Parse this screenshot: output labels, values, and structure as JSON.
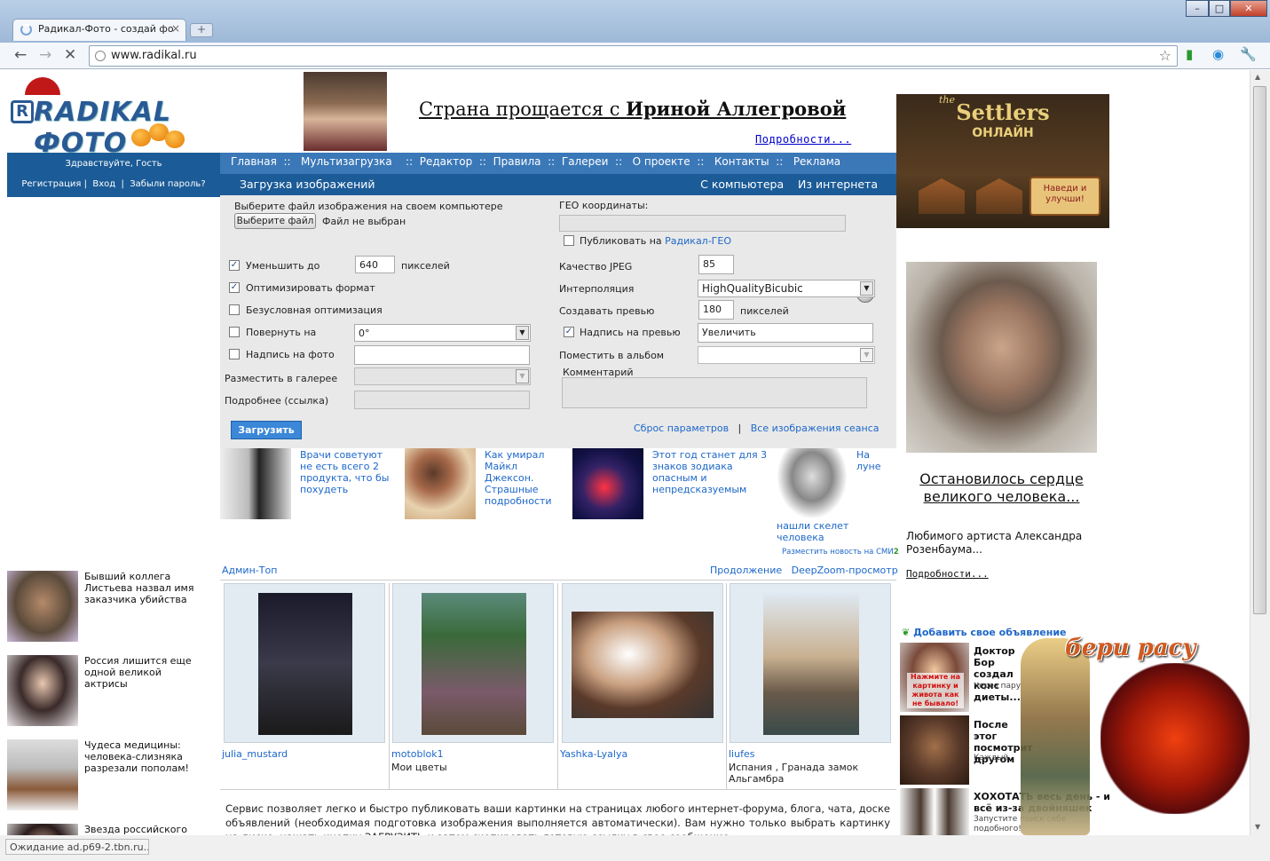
{
  "browser": {
    "tab_title": "Радикал-Фото - создай фо",
    "tab_close": "×",
    "new_tab": "+",
    "url": "www.radikal.ru",
    "status": "Ожидание ad.p69-2.tbn.ru...",
    "win_min": "–",
    "win_max": "□",
    "win_close": "✕"
  },
  "logo": {
    "letter": "R",
    "text": "RADIKAL ФОТО"
  },
  "banner": {
    "title_prefix": "Страна прощается с ",
    "title_bold": "Ириной Аллегровой",
    "more": "Подробности..."
  },
  "user_box": {
    "greeting": "Здравствуйте, Гость",
    "register": "Регистрация",
    "login": "Вход",
    "forgot": "Забыли пароль?",
    "sep": "|"
  },
  "nav": {
    "items": [
      "Главная",
      "Мультизагрузка",
      "Редактор",
      "Правила",
      "Галереи",
      "О проекте",
      "Контакты",
      "Реклама"
    ],
    "sep": "::"
  },
  "upload": {
    "title": "Загрузка изображений",
    "from_computer": "С компьютера",
    "from_internet": "Из интернета",
    "choose_label": "Выберите файл изображения на своем компьютере",
    "choose_button": "Выберите файл",
    "no_file": "Файл не выбран",
    "reduce_label": "Уменьшить до",
    "reduce_value": "640",
    "pixels": "пикселей",
    "optimize_label": "Оптимизировать формат",
    "force_opt_label": "Безусловная оптимизация",
    "rotate_label": "Повернуть на",
    "rotate_value": "0°",
    "caption_label": "Надпись на фото",
    "gallery_label": "Разместить в галерее",
    "more_link_label": "Подробнее (ссылка)",
    "geo_label": "ГЕО координаты:",
    "geo_publish": "Публиковать на",
    "geo_link": "Радикал-ГЕО",
    "jpeg_label": "Качество JPEG",
    "jpeg_value": "85",
    "interp_label": "Интерполяция",
    "interp_value": "HighQualityBicubic",
    "preview_label": "Создавать превью",
    "preview_value": "180",
    "preview_caption_label": "Надпись на превью",
    "preview_caption_value": "Увеличить",
    "album_label": "Поместить в альбом",
    "comment_label": "Комментарий",
    "submit": "Загрузить",
    "reset": "Сброс параметров",
    "all_images": "Все изображения сеанса",
    "sep": "|"
  },
  "news": [
    {
      "text": "Врачи советуют не есть всего 2 продукта, что бы похудеть"
    },
    {
      "text": "Как умирал Майкл Джексон. Страшные подробности"
    },
    {
      "text": "Этот год станет для 3 знаков зодиака опасным и непредсказуемым"
    },
    {
      "text_a": "На луне",
      "text_b": "нашли скелет человека"
    }
  ],
  "news_place": {
    "text": "Разместить новость на СМИ",
    "suffix": "2"
  },
  "gallery": {
    "admin_top": "Админ-Топ",
    "continue": "Продолжение",
    "deepzoom": "DeepZoom-просмотр",
    "items": [
      {
        "user": "julia_mustard",
        "desc": ""
      },
      {
        "user": "motoblok1",
        "desc": "Мои цветы"
      },
      {
        "user": "Yashka-Lyalya",
        "desc": ""
      },
      {
        "user": "liufes",
        "desc": "Испания , Гранада замок Альгамбра"
      }
    ]
  },
  "left_news": [
    "Бывший коллега Листьева назвал имя заказчика убийства",
    "Россия лишится еще одной великой актрисы",
    "Чудеса медицины: человека-слизняка разрезали пополам!",
    "Звезда российского"
  ],
  "service_text": "Сервис позволяет легко и быстро публиковать ваши картинки на страницах любого интернет-форума, блога, чата, доске объявлений (необходимая подготовка изображения выполняется автоматически). Вам нужно только выбрать картинку на диске, нажать кнопку ЗАГРУЗИТЬ и затем скопировать готовую ссылку в свое сообщение.",
  "settlers_ad": {
    "the": "the",
    "title": "Settlers",
    "sub": "ОНЛАЙН",
    "scroll": "Наведи и улучши!"
  },
  "rosenbaum": {
    "title": "Остановилось сердце великого человека...",
    "desc": "Любимого артиста Александра Розенбаума...",
    "more": "Подробности..."
  },
  "ads": {
    "add": "Добавить свое объявление",
    "items": [
      {
        "title": "Доктор Бор создал конс диеты...",
        "sub": "Через пару",
        "img_caption": "Нажмите на картинку и живота как не бывало!"
      },
      {
        "title": "После этог посмотрит другом",
        "sub": "Каждый"
      },
      {
        "title": "ХОХОТАТЬ весь день - и всё из-за двойняшек",
        "sub": "Запустите поиск себе подобного!"
      }
    ],
    "game_title": "бери расу"
  },
  "colors": {
    "nav_blue": "#3b78b8",
    "dark_blue": "#1b5b97",
    "link": "#1d67c9",
    "form_bg": "#e9e9e9"
  }
}
